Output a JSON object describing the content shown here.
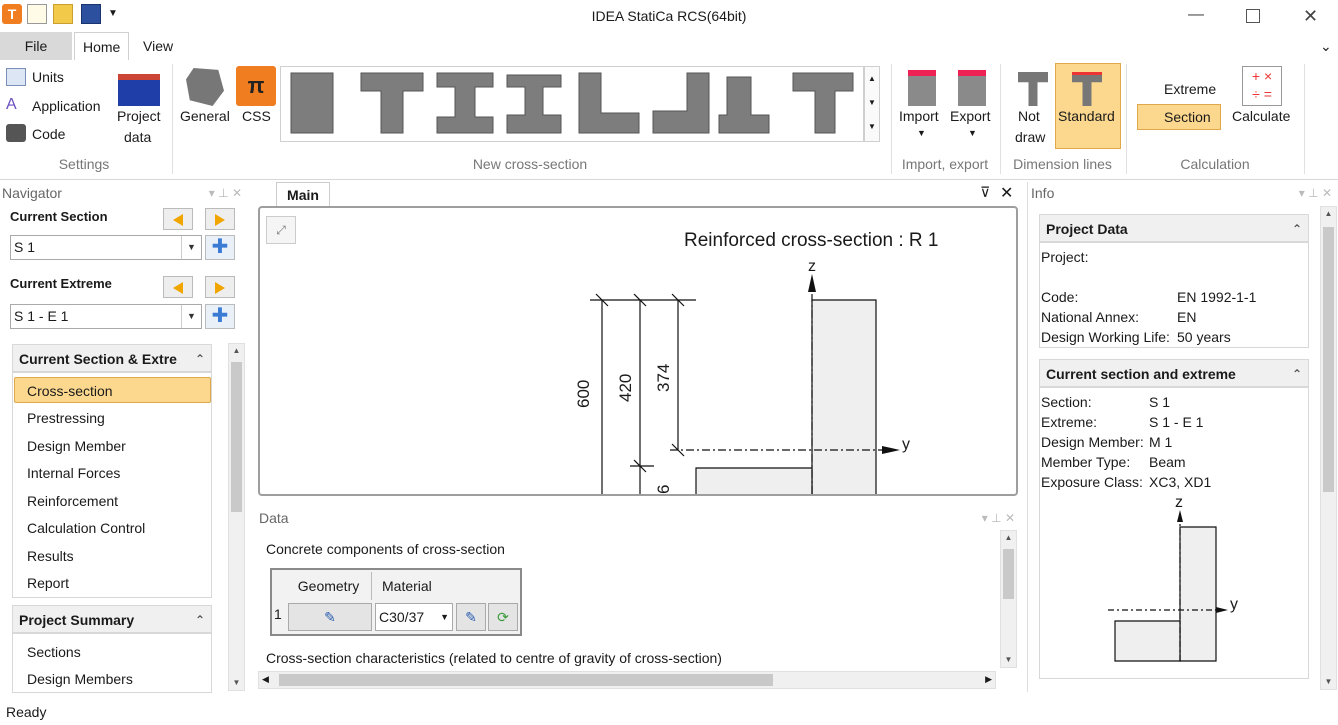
{
  "window": {
    "title": "IDEA StatiCa RCS(64bit)"
  },
  "menu": {
    "file": "File",
    "home": "Home",
    "view": "View"
  },
  "ribbon": {
    "settings": {
      "units": "Units",
      "application": "Application",
      "code": "Code",
      "project_data_1": "Project",
      "project_data_2": "data",
      "label": "Settings"
    },
    "new_cs": {
      "general": "General",
      "css": "CSS",
      "label": "New cross-section"
    },
    "import_export": {
      "import": "Import",
      "export": "Export",
      "label": "Import, export"
    },
    "dimension": {
      "not_draw_1": "Not",
      "not_draw_2": "draw",
      "standard": "Standard",
      "label": "Dimension lines"
    },
    "calculation": {
      "extreme": "Extreme",
      "section": "Section",
      "calculate": "Calculate",
      "label": "Calculation"
    }
  },
  "navigator": {
    "title": "Navigator",
    "current_section_label": "Current Section",
    "current_section_value": "S 1",
    "current_extreme_label": "Current Extreme",
    "current_extreme_value": "S 1 - E 1",
    "group1": {
      "title": "Current Section & Extre",
      "items": [
        "Cross-section",
        "Prestressing",
        "Design Member",
        "Internal Forces",
        "Reinforcement",
        "Calculation Control",
        "Results",
        "Report"
      ]
    },
    "group2": {
      "title": "Project Summary",
      "items": [
        "Sections",
        "Design Members"
      ]
    }
  },
  "main": {
    "tab": "Main",
    "drawing_title": "Reinforced cross-section : R 1",
    "axis_z": "z",
    "axis_y": "y",
    "dims": [
      "600",
      "420",
      "374",
      "6"
    ]
  },
  "data_panel": {
    "title": "Data",
    "concrete_label": "Concrete components of cross-section",
    "col_geometry": "Geometry",
    "col_material": "Material",
    "row_index": "1",
    "material_value": "C30/37",
    "characteristics_label": "Cross-section characteristics (related to centre of gravity of cross-section)"
  },
  "info": {
    "title": "Info",
    "project_data": {
      "title": "Project Data",
      "project_label": "Project:",
      "code_label": "Code:",
      "code_value": "EN 1992-1-1",
      "annex_label": "National Annex:",
      "annex_value": "EN",
      "life_label": "Design Working Life:",
      "life_value": "50 years"
    },
    "current": {
      "title": "Current section and extreme",
      "section_label": "Section:",
      "section_value": "S 1",
      "extreme_label": "Extreme:",
      "extreme_value": "S 1 - E 1",
      "member_label": "Design Member:",
      "member_value": "M 1",
      "type_label": "Member Type:",
      "type_value": "Beam",
      "exposure_label": "Exposure Class:",
      "exposure_value": "XC3, XD1",
      "axis_z": "z",
      "axis_y": "y"
    }
  },
  "status": {
    "text": "Ready"
  },
  "colors": {
    "accent_orange": "#f5a623",
    "selected_bg": "#fcd88e",
    "blue": "#3b7bd4"
  }
}
